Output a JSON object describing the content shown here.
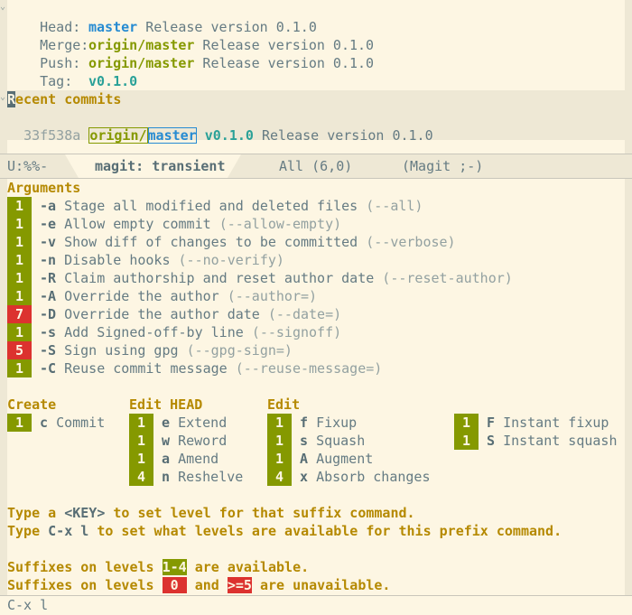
{
  "header": {
    "head_label": "Head:",
    "head_branch": "master",
    "head_msg": " Release version 0.1.0",
    "merge_label": "Merge:",
    "merge_branch": "origin/master",
    "merge_msg": " Release version 0.1.0",
    "push_label": "Push:",
    "push_branch": "origin/master",
    "push_msg": " Release version 0.1.0",
    "tag_label": "Tag:",
    "tag_value": "v0.1.0"
  },
  "recent": {
    "heading_first": "R",
    "heading_rest": "ecent commits",
    "commit_hash": "33f538a",
    "remote_prefix": "origin/",
    "remote_branch": "master",
    "tag": "v0.1.0",
    "message": " Release version 0.1.0"
  },
  "modeline": {
    "status": "U:%%-",
    "buffer": "magit: transient",
    "position": "All (6,0)",
    "mode": "(Magit ;-)"
  },
  "arguments": {
    "heading": "Arguments",
    "items": [
      {
        "level": "1",
        "level_color": "#859900",
        "key": "-a",
        "desc": " Stage all modified and deleted files ",
        "flag": "(--all)"
      },
      {
        "level": "1",
        "level_color": "#859900",
        "key": "-e",
        "desc": " Allow empty commit ",
        "flag": "(--allow-empty)"
      },
      {
        "level": "1",
        "level_color": "#859900",
        "key": "-v",
        "desc": " Show diff of changes to be committed ",
        "flag": "(--verbose)"
      },
      {
        "level": "1",
        "level_color": "#859900",
        "key": "-n",
        "desc": " Disable hooks ",
        "flag": "(--no-verify)"
      },
      {
        "level": "1",
        "level_color": "#859900",
        "key": "-R",
        "desc": " Claim authorship and reset author date ",
        "flag": "(--reset-author)"
      },
      {
        "level": "1",
        "level_color": "#859900",
        "key": "-A",
        "desc": " Override the author ",
        "flag": "(--author=)"
      },
      {
        "level": "7",
        "level_color": "#dc322f",
        "key": "-D",
        "desc": " Override the author date ",
        "flag": "(--date=)"
      },
      {
        "level": "1",
        "level_color": "#859900",
        "key": "-s",
        "desc": " Add Signed-off-by line ",
        "flag": "(--signoff)"
      },
      {
        "level": "5",
        "level_color": "#dc322f",
        "key": "-S",
        "desc": " Sign using gpg ",
        "flag": "(--gpg-sign=)"
      },
      {
        "level": "1",
        "level_color": "#859900",
        "key": "-C",
        "desc": " Reuse commit message ",
        "flag": "(--reuse-message=)"
      }
    ]
  },
  "create": {
    "heading": "Create",
    "items": [
      {
        "level": "1",
        "key": "c",
        "label": "Commit"
      }
    ]
  },
  "edit_head": {
    "heading": "Edit HEAD",
    "items": [
      {
        "level": "1",
        "key": "e",
        "label": "Extend"
      },
      {
        "level": "1",
        "key": "w",
        "label": "Reword"
      },
      {
        "level": "1",
        "key": "a",
        "label": "Amend"
      },
      {
        "level": "4",
        "key": "n",
        "label": "Reshelve"
      }
    ]
  },
  "edit": {
    "heading": "Edit",
    "items": [
      {
        "level": "1",
        "key": "f",
        "label": "Fixup"
      },
      {
        "level": "1",
        "key": "s",
        "label": "Squash"
      },
      {
        "level": "1",
        "key": "A",
        "label": "Augment"
      },
      {
        "level": "4",
        "key": "x",
        "label": "Absorb changes"
      }
    ],
    "items2": [
      {
        "level": "1",
        "key": "F",
        "label": "Instant fixup"
      },
      {
        "level": "1",
        "key": "S",
        "label": "Instant squash"
      }
    ]
  },
  "help": {
    "line1_a": "Type a ",
    "line1_key": "<KEY>",
    "line1_b": " to set level for that suffix command.",
    "line2_a": "Type ",
    "line2_key": "C-x l",
    "line2_b": " to set what levels are available for this prefix command.",
    "avail_a": "Suffixes on levels ",
    "avail_badge": "1-4",
    "avail_b": " are available.",
    "unavail_a": "Suffixes on levels ",
    "unavail_badge1": " 0 ",
    "unavail_mid": " and ",
    "unavail_badge2": ">=5",
    "unavail_b": " are unavailable."
  },
  "echo": {
    "text": "C-x l"
  }
}
